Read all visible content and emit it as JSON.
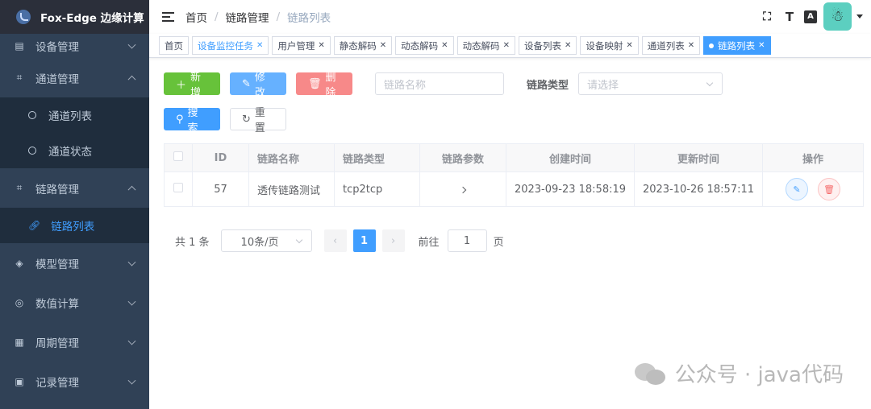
{
  "sidebar": {
    "app_title": "Fox-Edge 边缘计算",
    "items": [
      {
        "label": "设备管理",
        "icon": "list-icon"
      },
      {
        "label": "通道管理",
        "icon": "channel-icon"
      },
      {
        "label": "链路管理",
        "icon": "link-group-icon"
      },
      {
        "label": "模型管理",
        "icon": "cube-icon"
      },
      {
        "label": "数值计算",
        "icon": "calc-icon"
      },
      {
        "label": "周期管理",
        "icon": "calendar-icon"
      },
      {
        "label": "记录管理",
        "icon": "record-icon"
      }
    ],
    "channel_sub": [
      "通道列表",
      "通道状态"
    ],
    "link_sub": [
      "链路列表"
    ]
  },
  "navbar": {
    "breadcrumb": [
      "首页",
      "链路管理",
      "链路列表"
    ],
    "separator": "/"
  },
  "tags": [
    {
      "label": "首页",
      "closable": false
    },
    {
      "label": "设备监控任务",
      "closable": true
    },
    {
      "label": "用户管理",
      "closable": true
    },
    {
      "label": "静态解码",
      "closable": true
    },
    {
      "label": "动态解码",
      "closable": true
    },
    {
      "label": "动态解码",
      "closable": true
    },
    {
      "label": "设备列表",
      "closable": true
    },
    {
      "label": "设备映射",
      "closable": true
    },
    {
      "label": "通道列表",
      "closable": true
    },
    {
      "label": "链路列表",
      "closable": true
    }
  ],
  "toolbar": {
    "add": "新增",
    "edit": "修改",
    "delete": "删除",
    "name_placeholder": "链路名称",
    "type_label": "链路类型",
    "type_placeholder": "请选择",
    "search": "搜索",
    "reset": "重置"
  },
  "table": {
    "headers": [
      "ID",
      "链路名称",
      "链路类型",
      "链路参数",
      "创建时间",
      "更新时间",
      "操作"
    ],
    "rows": [
      {
        "id": "57",
        "name": "透传链路测试",
        "type": "tcp2tcp",
        "created": "2023-09-23 18:58:19",
        "updated": "2023-10-26 18:57:11"
      }
    ]
  },
  "pagination": {
    "total": "共 1 条",
    "page_size": "10条/页",
    "current": "1",
    "goto_label": "前往",
    "goto_value": "1",
    "page_suffix": "页"
  },
  "watermark": "公众号 · java代码",
  "colors": {
    "sidebar_bg": "#304156",
    "accent": "#409eff",
    "success": "#67c23a",
    "danger": "#f78989"
  }
}
